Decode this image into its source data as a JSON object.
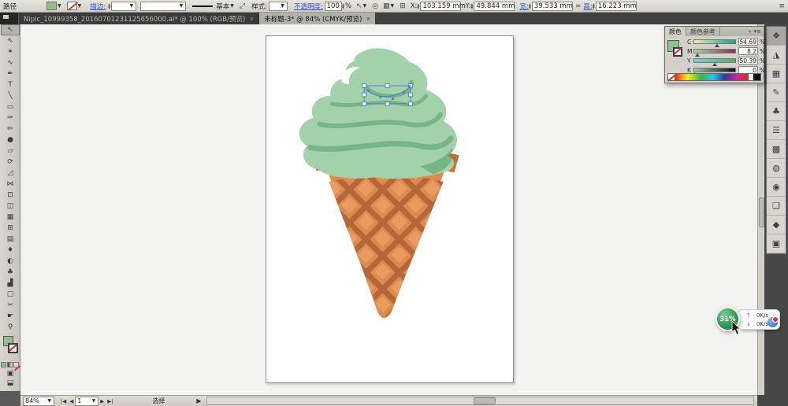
{
  "control_bar": {
    "context_label": "路径",
    "stroke_link": "描边:",
    "brush_name": "基本",
    "style_label": "样式:",
    "opacity_label": "不透明度:",
    "opacity_value": "100",
    "opacity_unit": "%",
    "transform": {
      "x_label": "X:",
      "x_value": "103.159 mm",
      "y_label": "Y:",
      "y_value": "49.844 mm",
      "w_label": "宽:",
      "w_value": "39.533 mm",
      "h_label": "高:",
      "h_value": "16.223 mm"
    }
  },
  "tab_bar": {
    "tabs": [
      {
        "label": "Nipic_10999358_20160701231125656000.ai* @ 100% (RGB/预览)",
        "close": "×",
        "active": false
      },
      {
        "label": "未标题-3* @ 84% (CMYK/预览)",
        "close": "×",
        "active": true
      }
    ]
  },
  "toolbar": {
    "tools": [
      {
        "name": "selection-tool",
        "glyph": "↖",
        "active": true
      },
      {
        "name": "direct-selection-tool",
        "glyph": "⇖"
      },
      {
        "name": "magic-wand-tool",
        "glyph": "✶"
      },
      {
        "name": "lasso-tool",
        "glyph": "∿"
      },
      {
        "name": "pen-tool",
        "glyph": "✒"
      },
      {
        "name": "type-tool",
        "glyph": "T"
      },
      {
        "name": "line-tool",
        "glyph": "╲"
      },
      {
        "name": "rectangle-tool",
        "glyph": "▭"
      },
      {
        "name": "paintbrush-tool",
        "glyph": "✑"
      },
      {
        "name": "pencil-tool",
        "glyph": "✏"
      },
      {
        "name": "blob-brush-tool",
        "glyph": "●"
      },
      {
        "name": "eraser-tool",
        "glyph": "▱"
      },
      {
        "name": "rotate-tool",
        "glyph": "⟳"
      },
      {
        "name": "scale-tool",
        "glyph": "◿"
      },
      {
        "name": "width-tool",
        "glyph": "⋈"
      },
      {
        "name": "free-transform-tool",
        "glyph": "⊡"
      },
      {
        "name": "shape-builder-tool",
        "glyph": "◫"
      },
      {
        "name": "perspective-grid-tool",
        "glyph": "▦"
      },
      {
        "name": "mesh-tool",
        "glyph": "⊞"
      },
      {
        "name": "gradient-tool",
        "glyph": "▤"
      },
      {
        "name": "eyedropper-tool",
        "glyph": "♦"
      },
      {
        "name": "blend-tool",
        "glyph": "◐"
      },
      {
        "name": "symbol-sprayer-tool",
        "glyph": "♣"
      },
      {
        "name": "column-graph-tool",
        "glyph": "▟"
      },
      {
        "name": "artboard-tool",
        "glyph": "▢"
      },
      {
        "name": "slice-tool",
        "glyph": "✂"
      },
      {
        "name": "hand-tool",
        "glyph": "☛"
      },
      {
        "name": "zoom-tool",
        "glyph": "⚲"
      }
    ]
  },
  "color_panel": {
    "tab_color": "颜色",
    "tab_color_guide": "颜色参考",
    "collapse_icon": "«",
    "menu_icon": "▾≡",
    "sliders": [
      {
        "label": "C",
        "value": "54.69",
        "unit": "%"
      },
      {
        "label": "M",
        "value": "8.2",
        "unit": "%"
      },
      {
        "label": "Y",
        "value": "50.39",
        "unit": "%"
      },
      {
        "label": "K",
        "value": "0",
        "unit": "%"
      }
    ]
  },
  "dock": {
    "icons": [
      {
        "name": "color-panel-icon",
        "glyph": "❖",
        "active": true
      },
      {
        "name": "color-guide-panel-icon",
        "glyph": "◮"
      },
      {
        "name": "swatches-panel-icon",
        "glyph": "▦"
      },
      {
        "name": "brushes-panel-icon",
        "glyph": "✎"
      },
      {
        "name": "symbols-panel-icon",
        "glyph": "♣"
      },
      {
        "name": "stroke-panel-icon",
        "glyph": "☰"
      },
      {
        "name": "gradient-panel-icon",
        "glyph": "▩"
      },
      {
        "name": "transparency-panel-icon",
        "glyph": "◍"
      },
      {
        "name": "appearance-panel-icon",
        "glyph": "◉"
      },
      {
        "name": "graphic-styles-panel-icon",
        "glyph": "❑"
      },
      {
        "name": "layers-panel-icon",
        "glyph": "◆"
      },
      {
        "name": "artboards-panel-icon",
        "glyph": "▣"
      }
    ]
  },
  "status_bar": {
    "zoom": "84%",
    "nav_first": "|◀",
    "nav_prev": "◀",
    "artboard_number": "1",
    "nav_next": "▶",
    "nav_last": "▶|",
    "status": "选择",
    "status_arrow": "▶"
  },
  "net_overlay": {
    "percent": "31%",
    "up_arrow": "↑",
    "up_value": "0K/s",
    "down_arrow": "↓",
    "down_value": "0K/s"
  },
  "artwork_colors": {
    "mint": "#a3d1aa",
    "mint_shade": "#76b585",
    "cone_body": "#dd8a4f",
    "cone_lattice": "#b5673a",
    "cone_rim": "#c9752f",
    "cone_diamond": "#ea9b60",
    "banner_yellow": "#f0bc4e",
    "selection_blue": "#4a82d8",
    "fill_swatch_green": "#8fbf8f"
  }
}
